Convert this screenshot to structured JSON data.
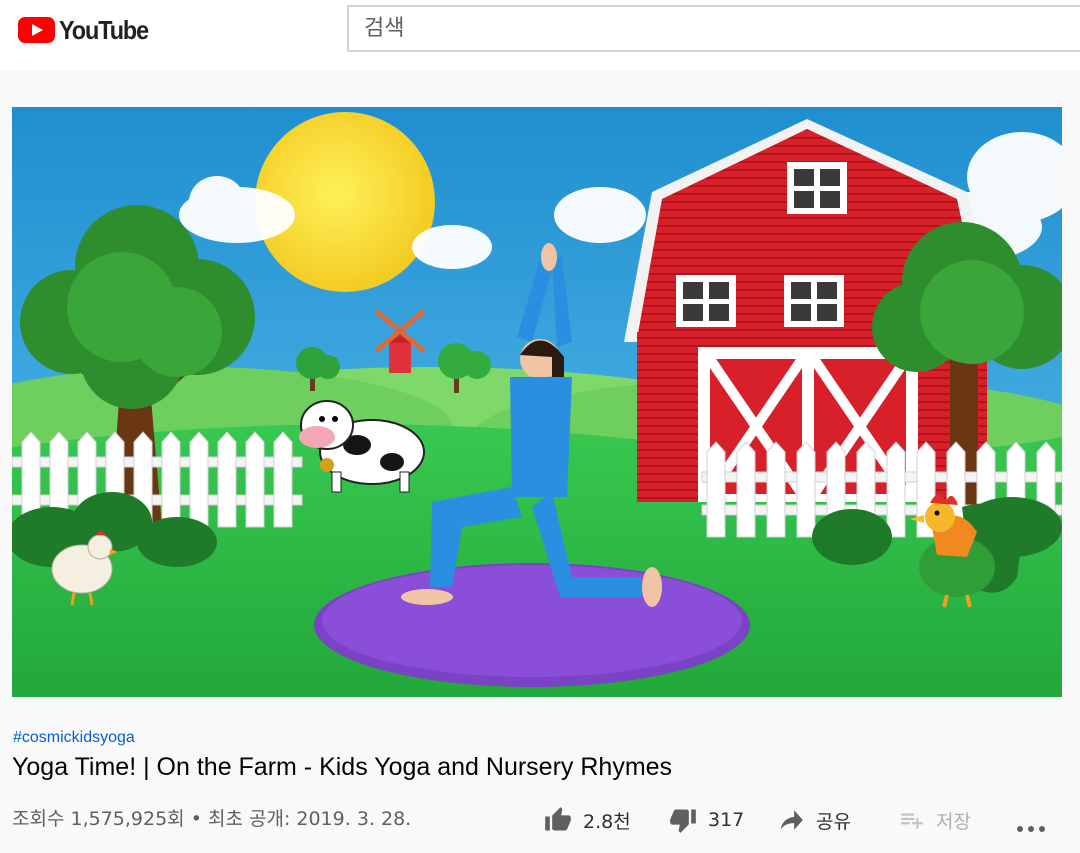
{
  "header": {
    "logo_text": "YouTube",
    "search_placeholder": "검색"
  },
  "video": {
    "hashtag": "#cosmickidsyoga",
    "title": "Yoga Time! | On the Farm - Kids Yoga and Nursery Rhymes",
    "views": "조회수 1,575,925회",
    "separator": "•",
    "published": "최초 공개: 2019. 3. 28."
  },
  "actions": {
    "like_count": "2.8천",
    "dislike_count": "317",
    "share_label": "공유",
    "save_label": "저장"
  },
  "colors": {
    "brand_red": "#ff0000",
    "link_blue": "#065fd4",
    "meta_gray": "#606060"
  },
  "icons": {
    "logo": "youtube-play-icon",
    "like": "thumbs-up-icon",
    "dislike": "thumbs-down-icon",
    "share": "share-arrow-icon",
    "save": "playlist-add-icon",
    "more": "more-horizontal-icon"
  }
}
